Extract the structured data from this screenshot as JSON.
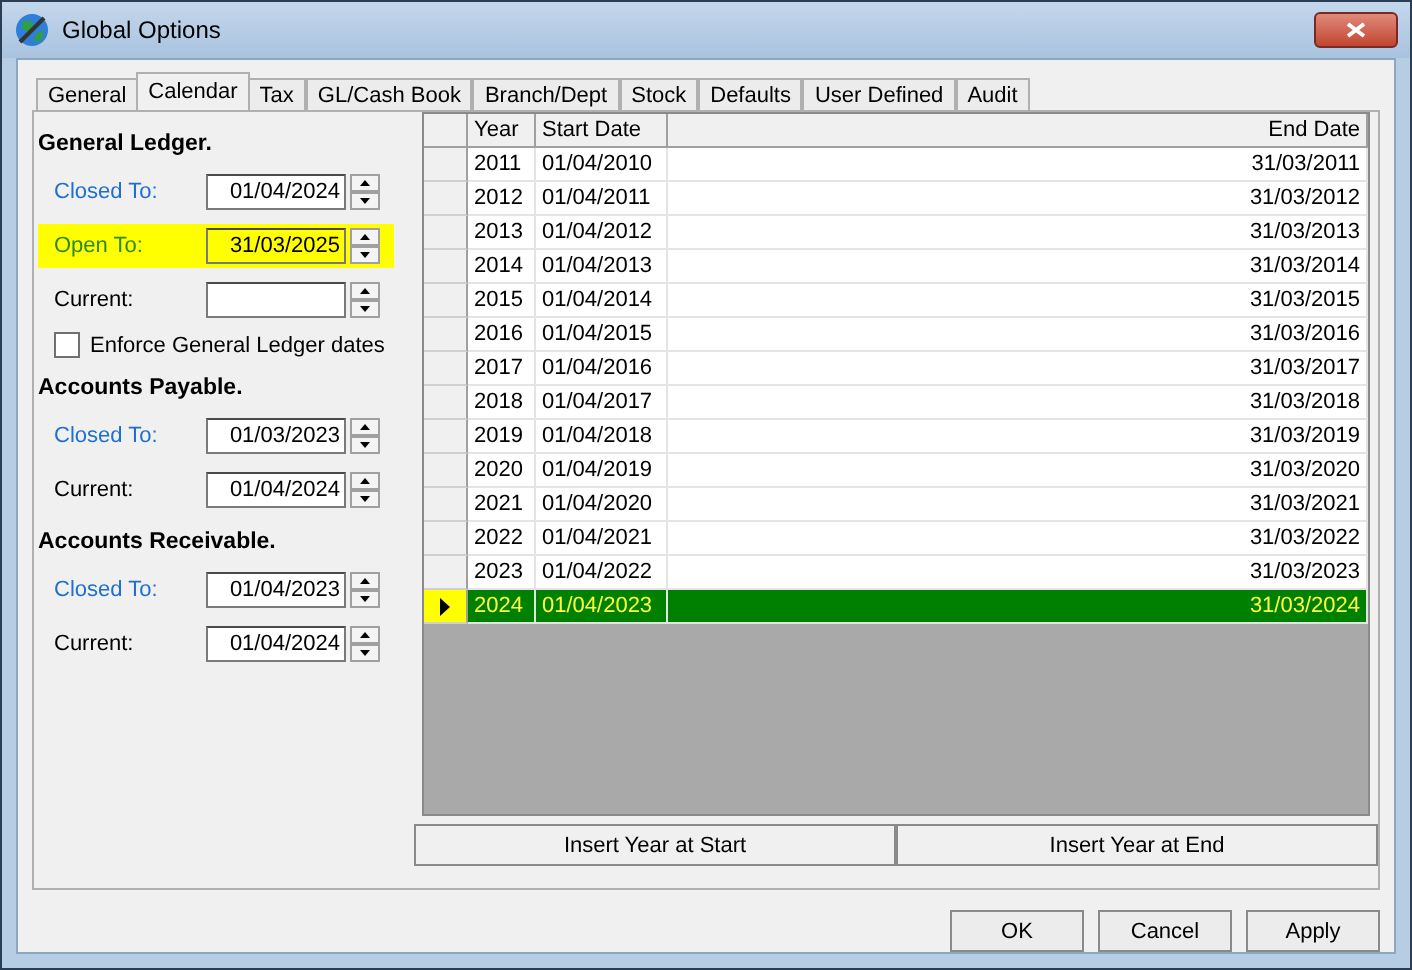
{
  "window": {
    "title": "Global Options"
  },
  "tabs": [
    {
      "label": "General",
      "selected": false
    },
    {
      "label": "Calendar",
      "selected": true
    },
    {
      "label": "Tax",
      "selected": false
    },
    {
      "label": "GL/Cash Book",
      "selected": false
    },
    {
      "label": "Branch/Dept",
      "selected": false
    },
    {
      "label": "Stock",
      "selected": false
    },
    {
      "label": "Defaults",
      "selected": false
    },
    {
      "label": "User Defined",
      "selected": false
    },
    {
      "label": "Audit",
      "selected": false
    }
  ],
  "sections": [
    {
      "title": "General Ledger.",
      "fields": [
        {
          "label": "Closed To:",
          "value": "01/04/2024",
          "color": "#1e6fd0",
          "highlighted": false
        },
        {
          "label": "Open To:",
          "value": "31/03/2025",
          "color": "#2c8a2c",
          "highlighted": true
        },
        {
          "label": "Current:",
          "color": "#000000",
          "highlighted": false
        }
      ],
      "checkbox": {
        "label": "Enforce General Ledger dates",
        "checked": false
      }
    },
    {
      "title": "Accounts Payable.",
      "fields": [
        {
          "label": "Closed To:",
          "value": "01/03/2023",
          "color": "#1e6fd0",
          "highlighted": false
        },
        {
          "label": "Current:",
          "value": "01/04/2024",
          "color": "#000000",
          "highlighted": false
        }
      ]
    },
    {
      "title": "Accounts Receivable.",
      "fields": [
        {
          "label": "Closed To:",
          "value": "01/04/2023",
          "color": "#1e6fd0",
          "highlighted": false
        },
        {
          "label": "Current:",
          "value": "01/04/2024",
          "color": "#000000",
          "highlighted": false
        }
      ]
    }
  ],
  "table": {
    "columns": [
      "Year",
      "Start Date",
      "End Date"
    ],
    "rows": [
      {
        "cells": [
          "2011",
          "01/04/2010",
          "31/03/2011"
        ],
        "selected": false
      },
      {
        "cells": [
          "2012",
          "01/04/2011",
          "31/03/2012"
        ],
        "selected": false
      },
      {
        "cells": [
          "2013",
          "01/04/2012",
          "31/03/2013"
        ],
        "selected": false
      },
      {
        "cells": [
          "2014",
          "01/04/2013",
          "31/03/2014"
        ],
        "selected": false
      },
      {
        "cells": [
          "2015",
          "01/04/2014",
          "31/03/2015"
        ],
        "selected": false
      },
      {
        "cells": [
          "2016",
          "01/04/2015",
          "31/03/2016"
        ],
        "selected": false
      },
      {
        "cells": [
          "2017",
          "01/04/2016",
          "31/03/2017"
        ],
        "selected": false
      },
      {
        "cells": [
          "2018",
          "01/04/2017",
          "31/03/2018"
        ],
        "selected": false
      },
      {
        "cells": [
          "2019",
          "01/04/2018",
          "31/03/2019"
        ],
        "selected": false
      },
      {
        "cells": [
          "2020",
          "01/04/2019",
          "31/03/2020"
        ],
        "selected": false
      },
      {
        "cells": [
          "2021",
          "01/04/2020",
          "31/03/2021"
        ],
        "selected": false
      },
      {
        "cells": [
          "2022",
          "01/04/2021",
          "31/03/2022"
        ],
        "selected": false
      },
      {
        "cells": [
          "2023",
          "01/04/2022",
          "31/03/2023"
        ],
        "selected": false
      },
      {
        "cells": [
          "2024",
          "01/04/2023",
          "31/03/2024"
        ],
        "selected": true
      }
    ]
  },
  "grid_buttons": [
    "Insert Year at Start",
    "Insert Year at End"
  ],
  "buttons": [
    "OK",
    "Cancel",
    "Apply"
  ]
}
